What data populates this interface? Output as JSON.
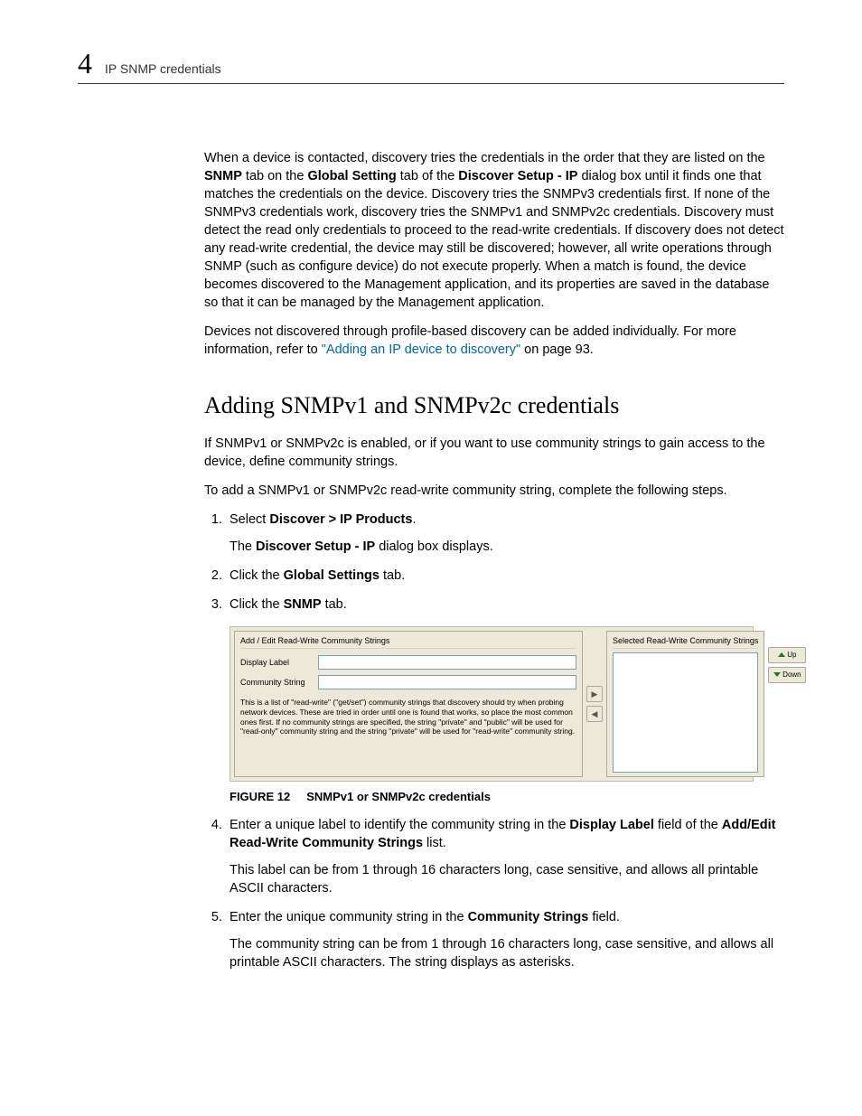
{
  "header": {
    "chapter_number": "4",
    "running_title": "IP SNMP credentials"
  },
  "body": {
    "para1_seg1": "When a device is contacted, discovery tries the credentials in the order that they are listed on the ",
    "para1_bold1": "SNMP",
    "para1_seg2": " tab on the ",
    "para1_bold2": "Global Setting",
    "para1_seg3": " tab of the ",
    "para1_bold3": "Discover Setup - IP",
    "para1_seg4": " dialog box until it finds one that matches the credentials on the device. Discovery tries the SNMPv3 credentials first. If none of the SNMPv3 credentials work, discovery tries the SNMPv1 and SNMPv2c credentials. Discovery must detect the read only credentials to proceed to the read-write credentials. If discovery does not detect any read-write credential, the device may still be discovered; however, all write operations through SNMP (such as configure device) do not execute properly. When a match is found, the device becomes discovered to the Management application, and its properties are saved in the database so that it can be managed by the Management application.",
    "para2_seg1": "Devices not discovered through profile-based discovery can be added individually. For more information, refer to ",
    "para2_link": "\"Adding an IP device to discovery\"",
    "para2_seg2": " on page 93.",
    "heading": "Adding SNMPv1 and SNMPv2c credentials",
    "para3": "If SNMPv1 or SNMPv2c is enabled, or if you want to use community strings to gain access to the device, define community strings.",
    "para4": "To add a SNMPv1 or SNMPv2c read-write community string, complete the following steps.",
    "step1_seg1": "Select ",
    "step1_bold": "Discover > IP Products",
    "step1_seg2": ".",
    "step1_sub_seg1": "The ",
    "step1_sub_bold": "Discover Setup - IP",
    "step1_sub_seg2": " dialog box displays.",
    "step2_seg1": "Click the ",
    "step2_bold": "Global Settings",
    "step2_seg2": " tab.",
    "step3_seg1": "Click the ",
    "step3_bold": "SNMP",
    "step3_seg2": " tab.",
    "figure_label": "FIGURE 12",
    "figure_title": "SNMPv1 or SNMPv2c credentials",
    "step4_seg1": "Enter a unique label to identify the community string in the ",
    "step4_bold1": "Display Label",
    "step4_seg2": " field of the ",
    "step4_bold2": "Add/Edit Read-Write Community Strings",
    "step4_seg3": " list.",
    "step4_sub": "This label can be from 1 through 16 characters long, case sensitive, and allows all printable ASCII characters.",
    "step5_seg1": "Enter the unique community string in the ",
    "step5_bold": "Community Strings",
    "step5_seg2": " field.",
    "step5_sub": "The community string can be from 1 through 16 characters long, case sensitive, and allows all printable ASCII characters. The string displays as asterisks."
  },
  "dialog": {
    "left_title": "Add / Edit Read-Write Community Strings",
    "display_label_text": "Display Label",
    "community_string_text": "Community String",
    "helper": "This is a list of \"read-write\" (\"get/set\") community strings that discovery should try when probing network devices. These are tried in order until one is found that works, so place the most common ones first. If no community strings are specified, the string \"private\" and \"public\" will be used for \"read-only\" community string and the string \"private\" will be used for \"read-write\" community string.",
    "right_title": "Selected Read-Write Community Strings",
    "up_label": "Up",
    "down_label": "Down"
  }
}
